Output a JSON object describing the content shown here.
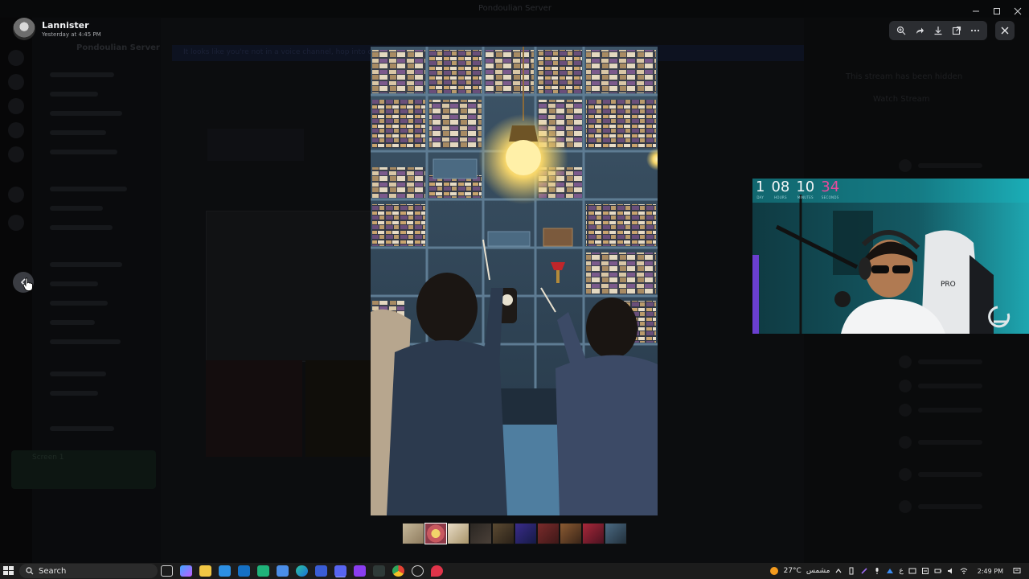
{
  "window": {
    "title": "Pondoulian Server"
  },
  "background": {
    "server_name": "Pondoulian Server",
    "banner_text": "It looks like you're not in a voice channel, hop into one",
    "stream_hidden_text": "This stream has been hidden",
    "watch_stream_text": "Watch Stream",
    "user_panel_name": "Screen 1"
  },
  "viewer": {
    "author_name": "Lannister",
    "timestamp": "Yesterday at 4:45 PM",
    "toolbar_icons": [
      "zoom-icon",
      "forward-icon",
      "download-icon",
      "open-external-icon",
      "more-icon"
    ],
    "close_icon": "close-icon",
    "prev_icon": "chevron-left-icon",
    "thumbnail_count": 10,
    "active_thumbnail_index": 1
  },
  "webcam": {
    "timer": [
      {
        "value": "1",
        "label": "DAY"
      },
      {
        "value": "08",
        "label": "HOURS"
      },
      {
        "value": "10",
        "label": "MINUTES"
      },
      {
        "value": "34",
        "label": "SECONDS"
      }
    ],
    "chair_text": "PRO"
  },
  "taskbar": {
    "search_label": "Search",
    "weather_temp": "27°C",
    "weather_desc": "مشمس",
    "lang": "ع",
    "clock": "2:49 PM"
  },
  "colors": {
    "accent_pink": "#e84b9c",
    "toolbar_bg": "#2b2d31",
    "taskbar_bg": "#1c1c1c",
    "webcam_cyan": "#24c7cf"
  }
}
